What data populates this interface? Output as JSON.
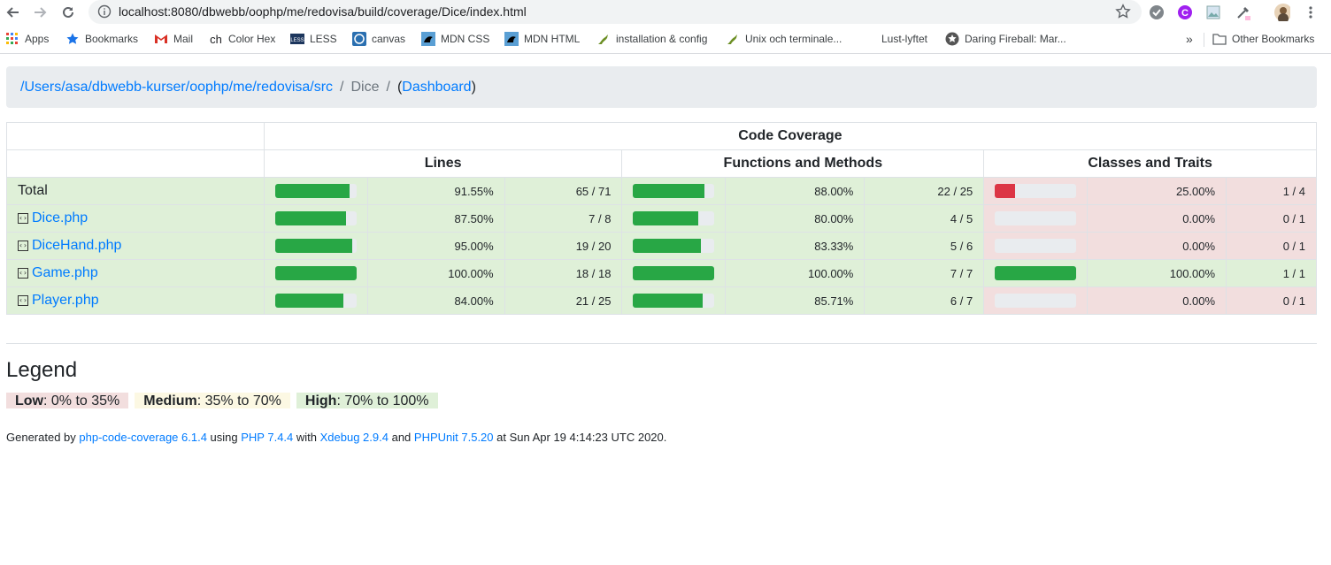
{
  "browser": {
    "url": "localhost:8080/dbwebb/oophp/me/redovisa/build/coverage/Dice/index.html"
  },
  "bookmarks": [
    {
      "label": "Apps",
      "icon": "apps-grid-icon"
    },
    {
      "label": "Bookmarks",
      "icon": "star-icon"
    },
    {
      "label": "Mail",
      "icon": "gmail-icon"
    },
    {
      "label": "Color Hex",
      "icon": "colorhex-icon"
    },
    {
      "label": "LESS",
      "icon": "less-icon"
    },
    {
      "label": "canvas",
      "icon": "canvas-icon"
    },
    {
      "label": "MDN CSS",
      "icon": "mdn-icon"
    },
    {
      "label": "MDN HTML",
      "icon": "mdn-icon"
    },
    {
      "label": "installation & config",
      "icon": "gecko-icon"
    },
    {
      "label": "Unix och terminale...",
      "icon": "gecko-icon"
    },
    {
      "label": "Lust-lyftet",
      "icon": "blank-icon"
    },
    {
      "label": "Daring Fireball: Mar...",
      "icon": "star-circle-icon"
    }
  ],
  "bookmarks_overflow": "»",
  "other_bookmarks": "Other Bookmarks",
  "breadcrumb": {
    "path": "/Users/asa/dbwebb-kurser/oophp/me/redovisa/src",
    "current": "Dice",
    "separator": "/",
    "open_paren": "(",
    "dashboard": "Dashboard",
    "close_paren": ")"
  },
  "table": {
    "header_main": "Code Coverage",
    "headers": [
      "Lines",
      "Functions and Methods",
      "Classes and Traits"
    ],
    "rows": [
      {
        "name": "Total",
        "is_file": false,
        "lines": {
          "pct": "91.55%",
          "count": "65 / 71",
          "value": 91.55,
          "level": "high"
        },
        "funcs": {
          "pct": "88.00%",
          "count": "22 / 25",
          "value": 88.0,
          "level": "high"
        },
        "classes": {
          "pct": "25.00%",
          "count": "1 / 4",
          "value": 25.0,
          "level": "low"
        }
      },
      {
        "name": "Dice.php",
        "is_file": true,
        "lines": {
          "pct": "87.50%",
          "count": "7 / 8",
          "value": 87.5,
          "level": "high"
        },
        "funcs": {
          "pct": "80.00%",
          "count": "4 / 5",
          "value": 80.0,
          "level": "high"
        },
        "classes": {
          "pct": "0.00%",
          "count": "0 / 1",
          "value": 0,
          "level": "low"
        }
      },
      {
        "name": "DiceHand.php",
        "is_file": true,
        "lines": {
          "pct": "95.00%",
          "count": "19 / 20",
          "value": 95.0,
          "level": "high"
        },
        "funcs": {
          "pct": "83.33%",
          "count": "5 / 6",
          "value": 83.33,
          "level": "high"
        },
        "classes": {
          "pct": "0.00%",
          "count": "0 / 1",
          "value": 0,
          "level": "low"
        }
      },
      {
        "name": "Game.php",
        "is_file": true,
        "lines": {
          "pct": "100.00%",
          "count": "18 / 18",
          "value": 100,
          "level": "high"
        },
        "funcs": {
          "pct": "100.00%",
          "count": "7 / 7",
          "value": 100,
          "level": "high"
        },
        "classes": {
          "pct": "100.00%",
          "count": "1 / 1",
          "value": 100,
          "level": "high"
        }
      },
      {
        "name": "Player.php",
        "is_file": true,
        "lines": {
          "pct": "84.00%",
          "count": "21 / 25",
          "value": 84.0,
          "level": "high"
        },
        "funcs": {
          "pct": "85.71%",
          "count": "6 / 7",
          "value": 85.71,
          "level": "high"
        },
        "classes": {
          "pct": "0.00%",
          "count": "0 / 1",
          "value": 0,
          "level": "low"
        }
      }
    ]
  },
  "legend": {
    "title": "Legend",
    "low_label": "Low",
    "low_range": ": 0% to 35%",
    "medium_label": "Medium",
    "medium_range": ": 35% to 70%",
    "high_label": "High",
    "high_range": ": 70% to 100%"
  },
  "footer": {
    "t1": "Generated by ",
    "l1": "php-code-coverage 6.1.4",
    "t2": " using ",
    "l2": "PHP 7.4.4",
    "t3": " with ",
    "l3": "Xdebug 2.9.4",
    "t4": " and ",
    "l4": "PHPUnit 7.5.20",
    "t5": " at Sun Apr 19 4:14:23 UTC 2020."
  },
  "colors": {
    "high_bar": "#28a745",
    "low_bar": "#dc3545",
    "success_bg": "#dff0d8",
    "danger_bg": "#f2dede",
    "link": "#007bff"
  }
}
